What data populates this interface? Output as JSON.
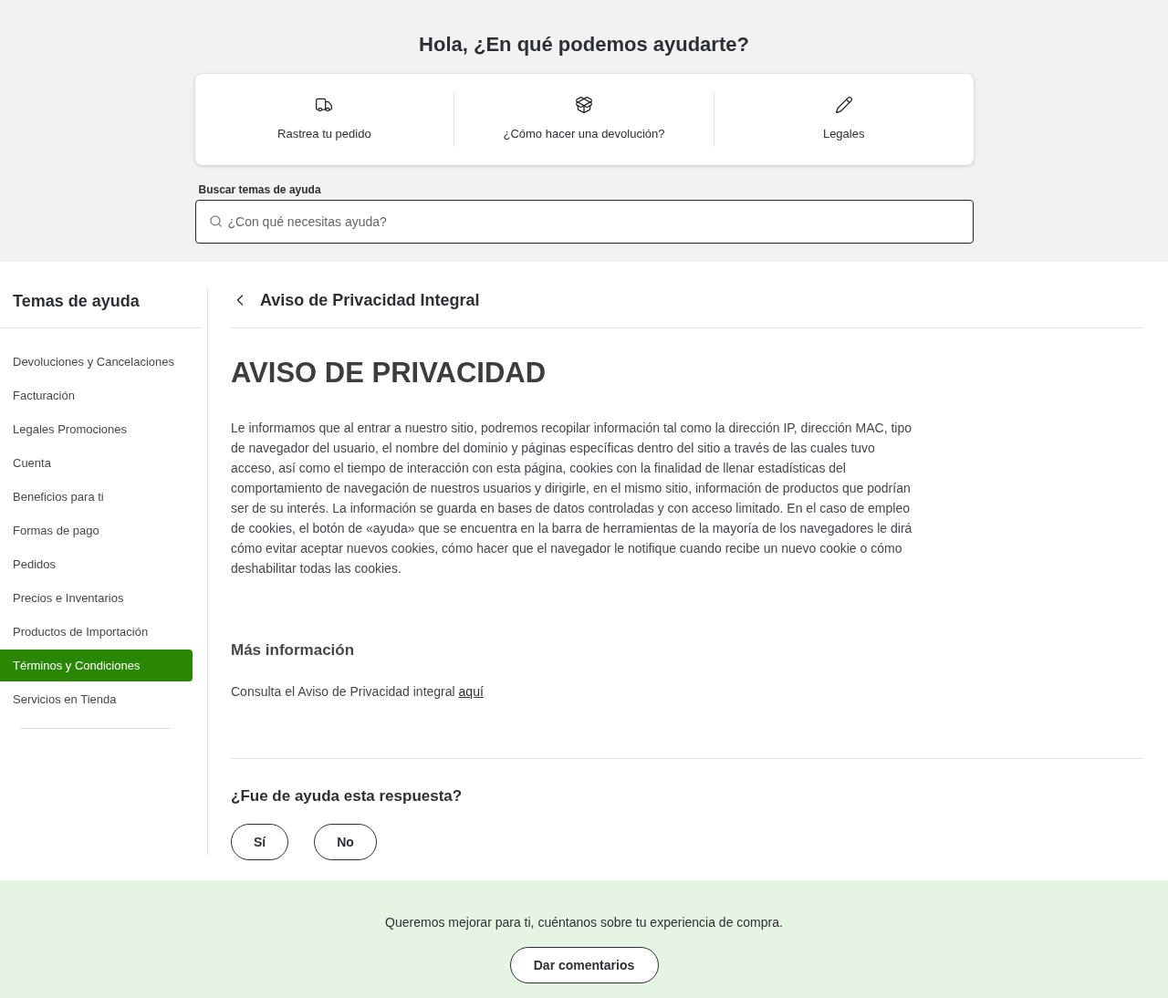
{
  "greeting": "Hola, ¿En qué podemos ayudarte?",
  "quick_links": [
    {
      "kind": "truck",
      "label": "Rastrea tu pedido"
    },
    {
      "kind": "return",
      "label": "¿Cómo hacer una devolución?"
    },
    {
      "kind": "pencil",
      "label": "Legales"
    }
  ],
  "search": {
    "label": "Buscar temas de ayuda",
    "placeholder": "¿Con qué necesitas ayuda?"
  },
  "sidebar": {
    "title": "Temas de ayuda",
    "items": [
      {
        "label": "Devoluciones y Cancelaciones",
        "selected": false
      },
      {
        "label": "Facturación",
        "selected": false
      },
      {
        "label": "Legales Promociones",
        "selected": false
      },
      {
        "label": "Cuenta",
        "selected": false
      },
      {
        "label": "Beneficios para ti",
        "selected": false
      },
      {
        "label": "Formas de pago",
        "selected": false
      },
      {
        "label": "Pedidos",
        "selected": false
      },
      {
        "label": "Precios e Inventarios",
        "selected": false
      },
      {
        "label": "Productos de Importación",
        "selected": false
      },
      {
        "label": "Términos y Condiciones",
        "selected": true
      },
      {
        "label": "Servicios en Tienda",
        "selected": false
      }
    ]
  },
  "article": {
    "breadcrumb": "Aviso de Privacidad Integral",
    "heading": "AVISO DE PRIVACIDAD",
    "body": "Le informamos que al entrar a nuestro sitio, podremos recopilar información tal como la dirección IP, dirección MAC, tipo de navegador del usuario, el nombre del dominio y páginas específicas dentro del sitio a través de las cuales tuvo acceso, así como el tiempo de interacción con esta página, cookies con la finalidad de llenar estadísticas del comportamiento de navegación de nuestros usuarios y dirigirle, en el mismo sitio, información de productos que podrían ser de su interés. La información se guarda en bases de datos controladas y con acceso limitado. En el caso de empleo de cookies, el botón de «ayuda» que se encuentra en la barra de herramientas de la mayoría de los navegadores le dirá cómo evitar aceptar nuevos cookies, cómo hacer que el navegador le notifique cuando recibe un nuevo cookie o cómo deshabilitar todas las cookies.",
    "more_title": "Más información",
    "more_text": "Consulta el Aviso de Privacidad integral",
    "more_link": "aquí"
  },
  "feedback": {
    "question": "¿Fue de ayuda esta respuesta?",
    "buttons": [
      "Sí",
      "No"
    ]
  },
  "footer": {
    "text": "Queremos mejorar para ti, cuéntanos sobre tu experiencia de compra.",
    "button": "Dar comentarios"
  }
}
